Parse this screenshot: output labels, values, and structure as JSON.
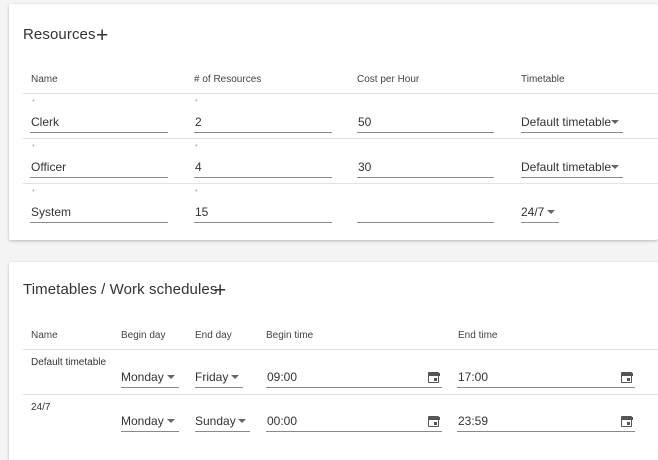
{
  "resources": {
    "title": "Resources",
    "add_icon": "plus-icon",
    "columns": [
      "Name",
      "# of Resources",
      "Cost per Hour",
      "Timetable"
    ],
    "rows": [
      {
        "required_mark": "*",
        "name": "Clerk",
        "count": "2",
        "cost": "50",
        "timetable": "Default timetable"
      },
      {
        "required_mark": "*",
        "name": "Officer",
        "count": "4",
        "cost": "30",
        "timetable": "Default timetable"
      },
      {
        "required_mark": "*",
        "name": "System",
        "count": "15",
        "cost": "",
        "timetable": "24/7"
      }
    ]
  },
  "timetables": {
    "title": "Timetables / Work schedules",
    "add_icon": "plus-icon",
    "columns": [
      "Name",
      "Begin day",
      "End day",
      "Begin time",
      "End time"
    ],
    "rows": [
      {
        "name": "Default timetable",
        "begin_day": "Monday",
        "end_day": "Friday",
        "begin_time": "09:00",
        "end_time": "17:00"
      },
      {
        "name": "24/7",
        "begin_day": "Monday",
        "end_day": "Sunday",
        "begin_time": "00:00",
        "end_time": "23:59"
      }
    ]
  }
}
